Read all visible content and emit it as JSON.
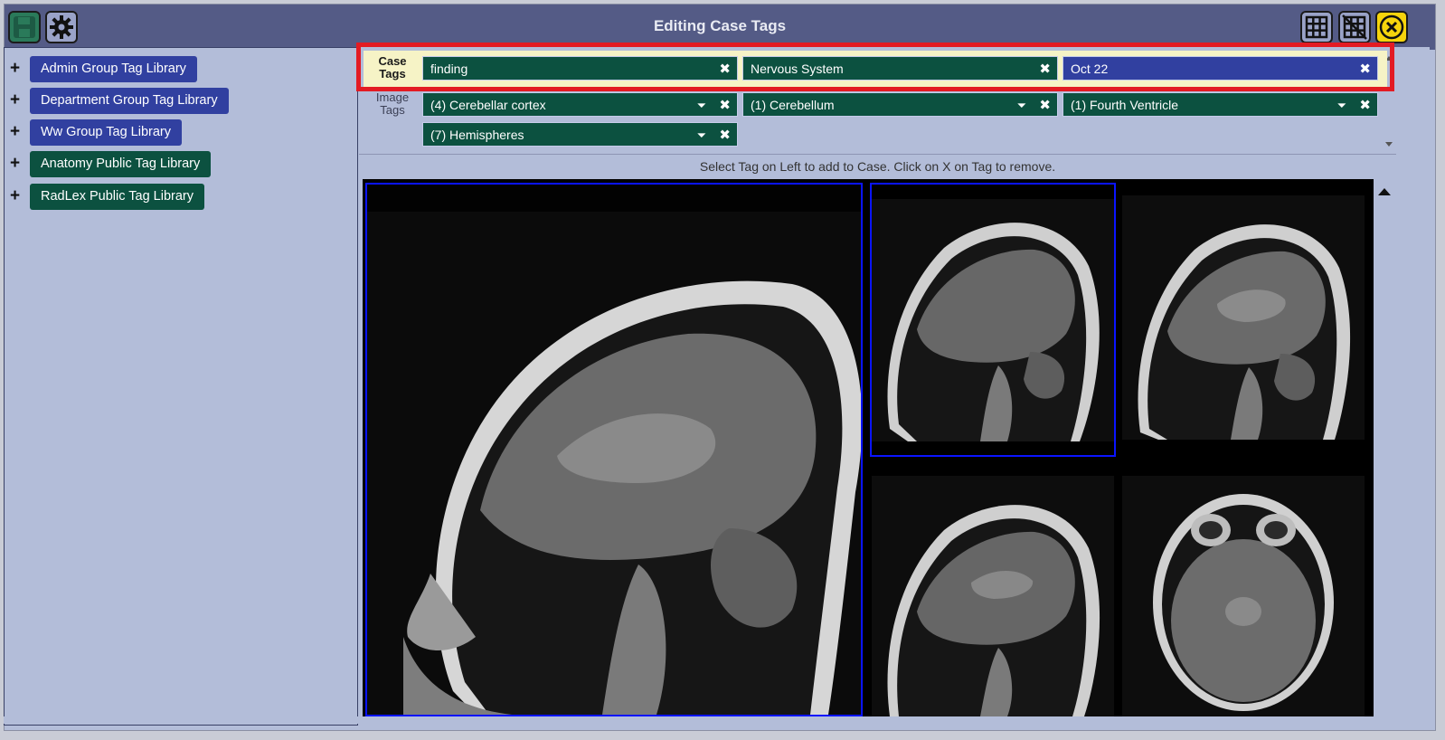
{
  "header": {
    "title": "Editing Case Tags",
    "icons": [
      "save-icon",
      "gear-icon",
      "grid-3x3-icon",
      "grid-hide-icon",
      "close-icon"
    ]
  },
  "libraries": [
    {
      "label": "Admin Group Tag Library",
      "color": "#3140a0"
    },
    {
      "label": "Department Group Tag Library",
      "color": "#3140a0"
    },
    {
      "label": "Ww Group Tag Library",
      "color": "#3140a0"
    },
    {
      "label": "Anatomy Public Tag Library",
      "color": "#0c5140"
    },
    {
      "label": "RadLex Public Tag Library",
      "color": "#0c5140"
    }
  ],
  "case_tags": {
    "label_line1": "Case",
    "label_line2": "Tags",
    "tags": [
      {
        "label": "finding",
        "color": "#0c5140"
      },
      {
        "label": "Nervous System",
        "color": "#0c5140"
      },
      {
        "label": "Oct 22",
        "color": "#3140a0"
      }
    ]
  },
  "image_tags": {
    "label_line1": "Image",
    "label_line2": "Tags",
    "tags": [
      {
        "label": "(4) Cerebellar cortex"
      },
      {
        "label": "(1) Cerebellum"
      },
      {
        "label": "(1) Fourth Ventricle"
      },
      {
        "label": "(7) Hemispheres"
      }
    ]
  },
  "info_text": "Select Tag on Left to add to Case. Click on X on Tag to remove.",
  "glyphs": {
    "plus": "+",
    "x": "✖",
    "filter": "⏷"
  },
  "colors": {
    "highlight": "#e31b23",
    "selection": "#0000ff",
    "header": "#545b86"
  }
}
